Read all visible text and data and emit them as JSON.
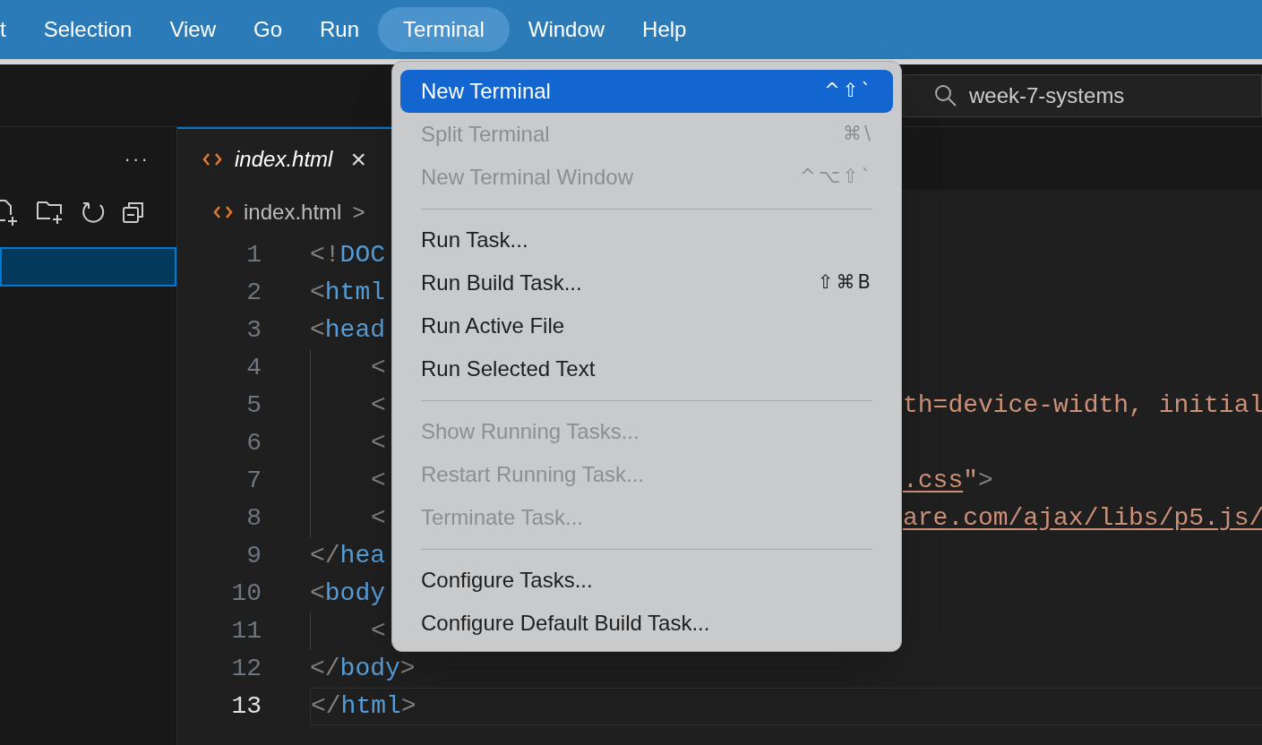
{
  "menu_bar": {
    "items": [
      {
        "label": "t",
        "selected": false
      },
      {
        "label": "Selection",
        "selected": false
      },
      {
        "label": "View",
        "selected": false
      },
      {
        "label": "Go",
        "selected": false
      },
      {
        "label": "Run",
        "selected": false
      },
      {
        "label": "Terminal",
        "selected": true
      },
      {
        "label": "Window",
        "selected": false
      },
      {
        "label": "Help",
        "selected": false
      }
    ]
  },
  "search": {
    "value": "week-7-systems"
  },
  "explorer": {
    "more": "···",
    "rows": [
      {
        "selected": true
      }
    ]
  },
  "tabs": [
    {
      "label": "index.html",
      "selected": true,
      "close": "×"
    }
  ],
  "breadcrumb": {
    "file": "index.html",
    "separator": ">"
  },
  "editor": {
    "lines": [
      {
        "number": "1",
        "current": false,
        "guide": false,
        "left": [
          {
            "text": "<!",
            "kind": "punct"
          },
          {
            "text": "DOC",
            "kind": "tag"
          }
        ]
      },
      {
        "number": "2",
        "current": false,
        "guide": false,
        "left": [
          {
            "text": "<",
            "kind": "punct"
          },
          {
            "text": "html",
            "kind": "tag"
          }
        ]
      },
      {
        "number": "3",
        "current": false,
        "guide": false,
        "left": [
          {
            "text": "<",
            "kind": "punct"
          },
          {
            "text": "head",
            "kind": "tag"
          }
        ]
      },
      {
        "number": "4",
        "current": false,
        "guide": true,
        "left": [
          {
            "text": "<",
            "kind": "punct"
          }
        ]
      },
      {
        "number": "5",
        "current": false,
        "guide": true,
        "left": [
          {
            "text": "<",
            "kind": "punct"
          }
        ],
        "right": [
          {
            "text": "th=device-width, initial",
            "kind": "string"
          }
        ]
      },
      {
        "number": "6",
        "current": false,
        "guide": true,
        "left": [
          {
            "text": "<",
            "kind": "punct"
          }
        ]
      },
      {
        "number": "7",
        "current": false,
        "guide": true,
        "left": [
          {
            "text": "<",
            "kind": "punct"
          }
        ],
        "right": [
          {
            "text": ".css",
            "kind": "link"
          },
          {
            "text": "\"",
            "kind": "string"
          },
          {
            "text": ">",
            "kind": "punct"
          }
        ]
      },
      {
        "number": "8",
        "current": false,
        "guide": true,
        "left": [
          {
            "text": "<",
            "kind": "punct"
          }
        ],
        "right": [
          {
            "text": "are.com/ajax/libs/p5.js/",
            "kind": "link"
          }
        ]
      },
      {
        "number": "9",
        "current": false,
        "guide": false,
        "left": [
          {
            "text": "</",
            "kind": "punct"
          },
          {
            "text": "hea",
            "kind": "tag"
          }
        ]
      },
      {
        "number": "10",
        "current": false,
        "guide": false,
        "left": [
          {
            "text": "<",
            "kind": "punct"
          },
          {
            "text": "body",
            "kind": "tag"
          }
        ]
      },
      {
        "number": "11",
        "current": false,
        "guide": true,
        "left": [
          {
            "text": "<",
            "kind": "punct"
          }
        ]
      },
      {
        "number": "12",
        "current": false,
        "guide": false,
        "left": [
          {
            "text": "</",
            "kind": "punct"
          },
          {
            "text": "body",
            "kind": "tag"
          },
          {
            "text": ">",
            "kind": "punct"
          }
        ]
      },
      {
        "number": "13",
        "current": true,
        "guide": false,
        "left": [
          {
            "text": "</",
            "kind": "punct"
          },
          {
            "text": "html",
            "kind": "tag"
          },
          {
            "text": ">",
            "kind": "punct"
          }
        ]
      }
    ]
  },
  "terminal_menu": {
    "items": [
      {
        "kind": "item",
        "label": "New Terminal",
        "shortcut": "^⇧`",
        "selected": true,
        "disabled": false
      },
      {
        "kind": "item",
        "label": "Split Terminal",
        "shortcut": "⌘\\",
        "selected": false,
        "disabled": true
      },
      {
        "kind": "item",
        "label": "New Terminal Window",
        "shortcut": "^⌥⇧`",
        "selected": false,
        "disabled": true
      },
      {
        "kind": "separator"
      },
      {
        "kind": "item",
        "label": "Run Task...",
        "selected": false,
        "disabled": false
      },
      {
        "kind": "item",
        "label": "Run Build Task...",
        "shortcut": "⇧⌘B",
        "selected": false,
        "disabled": false
      },
      {
        "kind": "item",
        "label": "Run Active File",
        "selected": false,
        "disabled": false
      },
      {
        "kind": "item",
        "label": "Run Selected Text",
        "selected": false,
        "disabled": false
      },
      {
        "kind": "separator"
      },
      {
        "kind": "item",
        "label": "Show Running Tasks...",
        "selected": false,
        "disabled": true
      },
      {
        "kind": "item",
        "label": "Restart Running Task...",
        "selected": false,
        "disabled": true
      },
      {
        "kind": "item",
        "label": "Terminate Task...",
        "selected": false,
        "disabled": true
      },
      {
        "kind": "separator"
      },
      {
        "kind": "item",
        "label": "Configure Tasks...",
        "selected": false,
        "disabled": false
      },
      {
        "kind": "item",
        "label": "Configure Default Build Task...",
        "selected": false,
        "disabled": false
      }
    ]
  }
}
